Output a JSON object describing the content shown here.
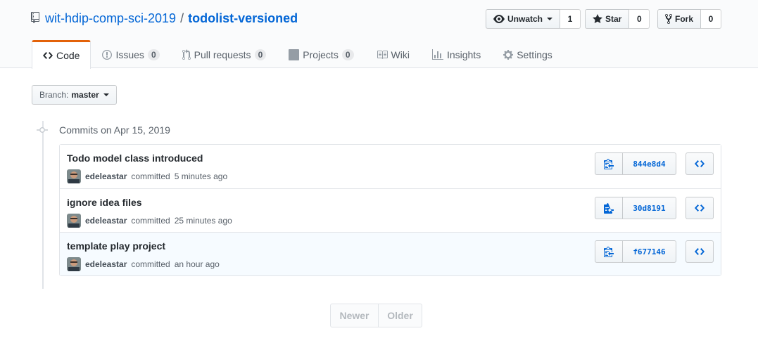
{
  "repo": {
    "owner": "wit-hdip-comp-sci-2019",
    "separator": "/",
    "name": "todolist-versioned"
  },
  "actions": {
    "watch_label": "Unwatch",
    "watch_count": "1",
    "star_label": "Star",
    "star_count": "0",
    "fork_label": "Fork",
    "fork_count": "0"
  },
  "tabs": [
    {
      "label": "Code",
      "icon": "code-icon",
      "selected": true
    },
    {
      "label": "Issues",
      "icon": "issue-opened-icon",
      "counter": "0"
    },
    {
      "label": "Pull requests",
      "icon": "git-pull-request-icon",
      "counter": "0"
    },
    {
      "label": "Projects",
      "icon": "project-icon",
      "counter": "0"
    },
    {
      "label": "Wiki",
      "icon": "book-icon"
    },
    {
      "label": "Insights",
      "icon": "graph-icon"
    },
    {
      "label": "Settings",
      "icon": "gear-icon"
    }
  ],
  "branch": {
    "label": "Branch:",
    "value": "master"
  },
  "commit_group": {
    "title": "Commits on Apr 15, 2019"
  },
  "commits": [
    {
      "message": "Todo model class introduced",
      "author": "edeleastar",
      "action": "committed",
      "time": "5 minutes ago",
      "sha": "844e8d4"
    },
    {
      "message": "ignore idea files",
      "author": "edeleastar",
      "action": "committed",
      "time": "25 minutes ago",
      "sha": "30d8191"
    },
    {
      "message": "template play project",
      "author": "edeleastar",
      "action": "committed",
      "time": "an hour ago",
      "sha": "f677146"
    }
  ],
  "pagination": {
    "newer": "Newer",
    "older": "Older"
  },
  "colors": {
    "link": "#0366d6",
    "tab_accent": "#e36209",
    "muted": "#586069",
    "border": "#e1e4e8"
  }
}
